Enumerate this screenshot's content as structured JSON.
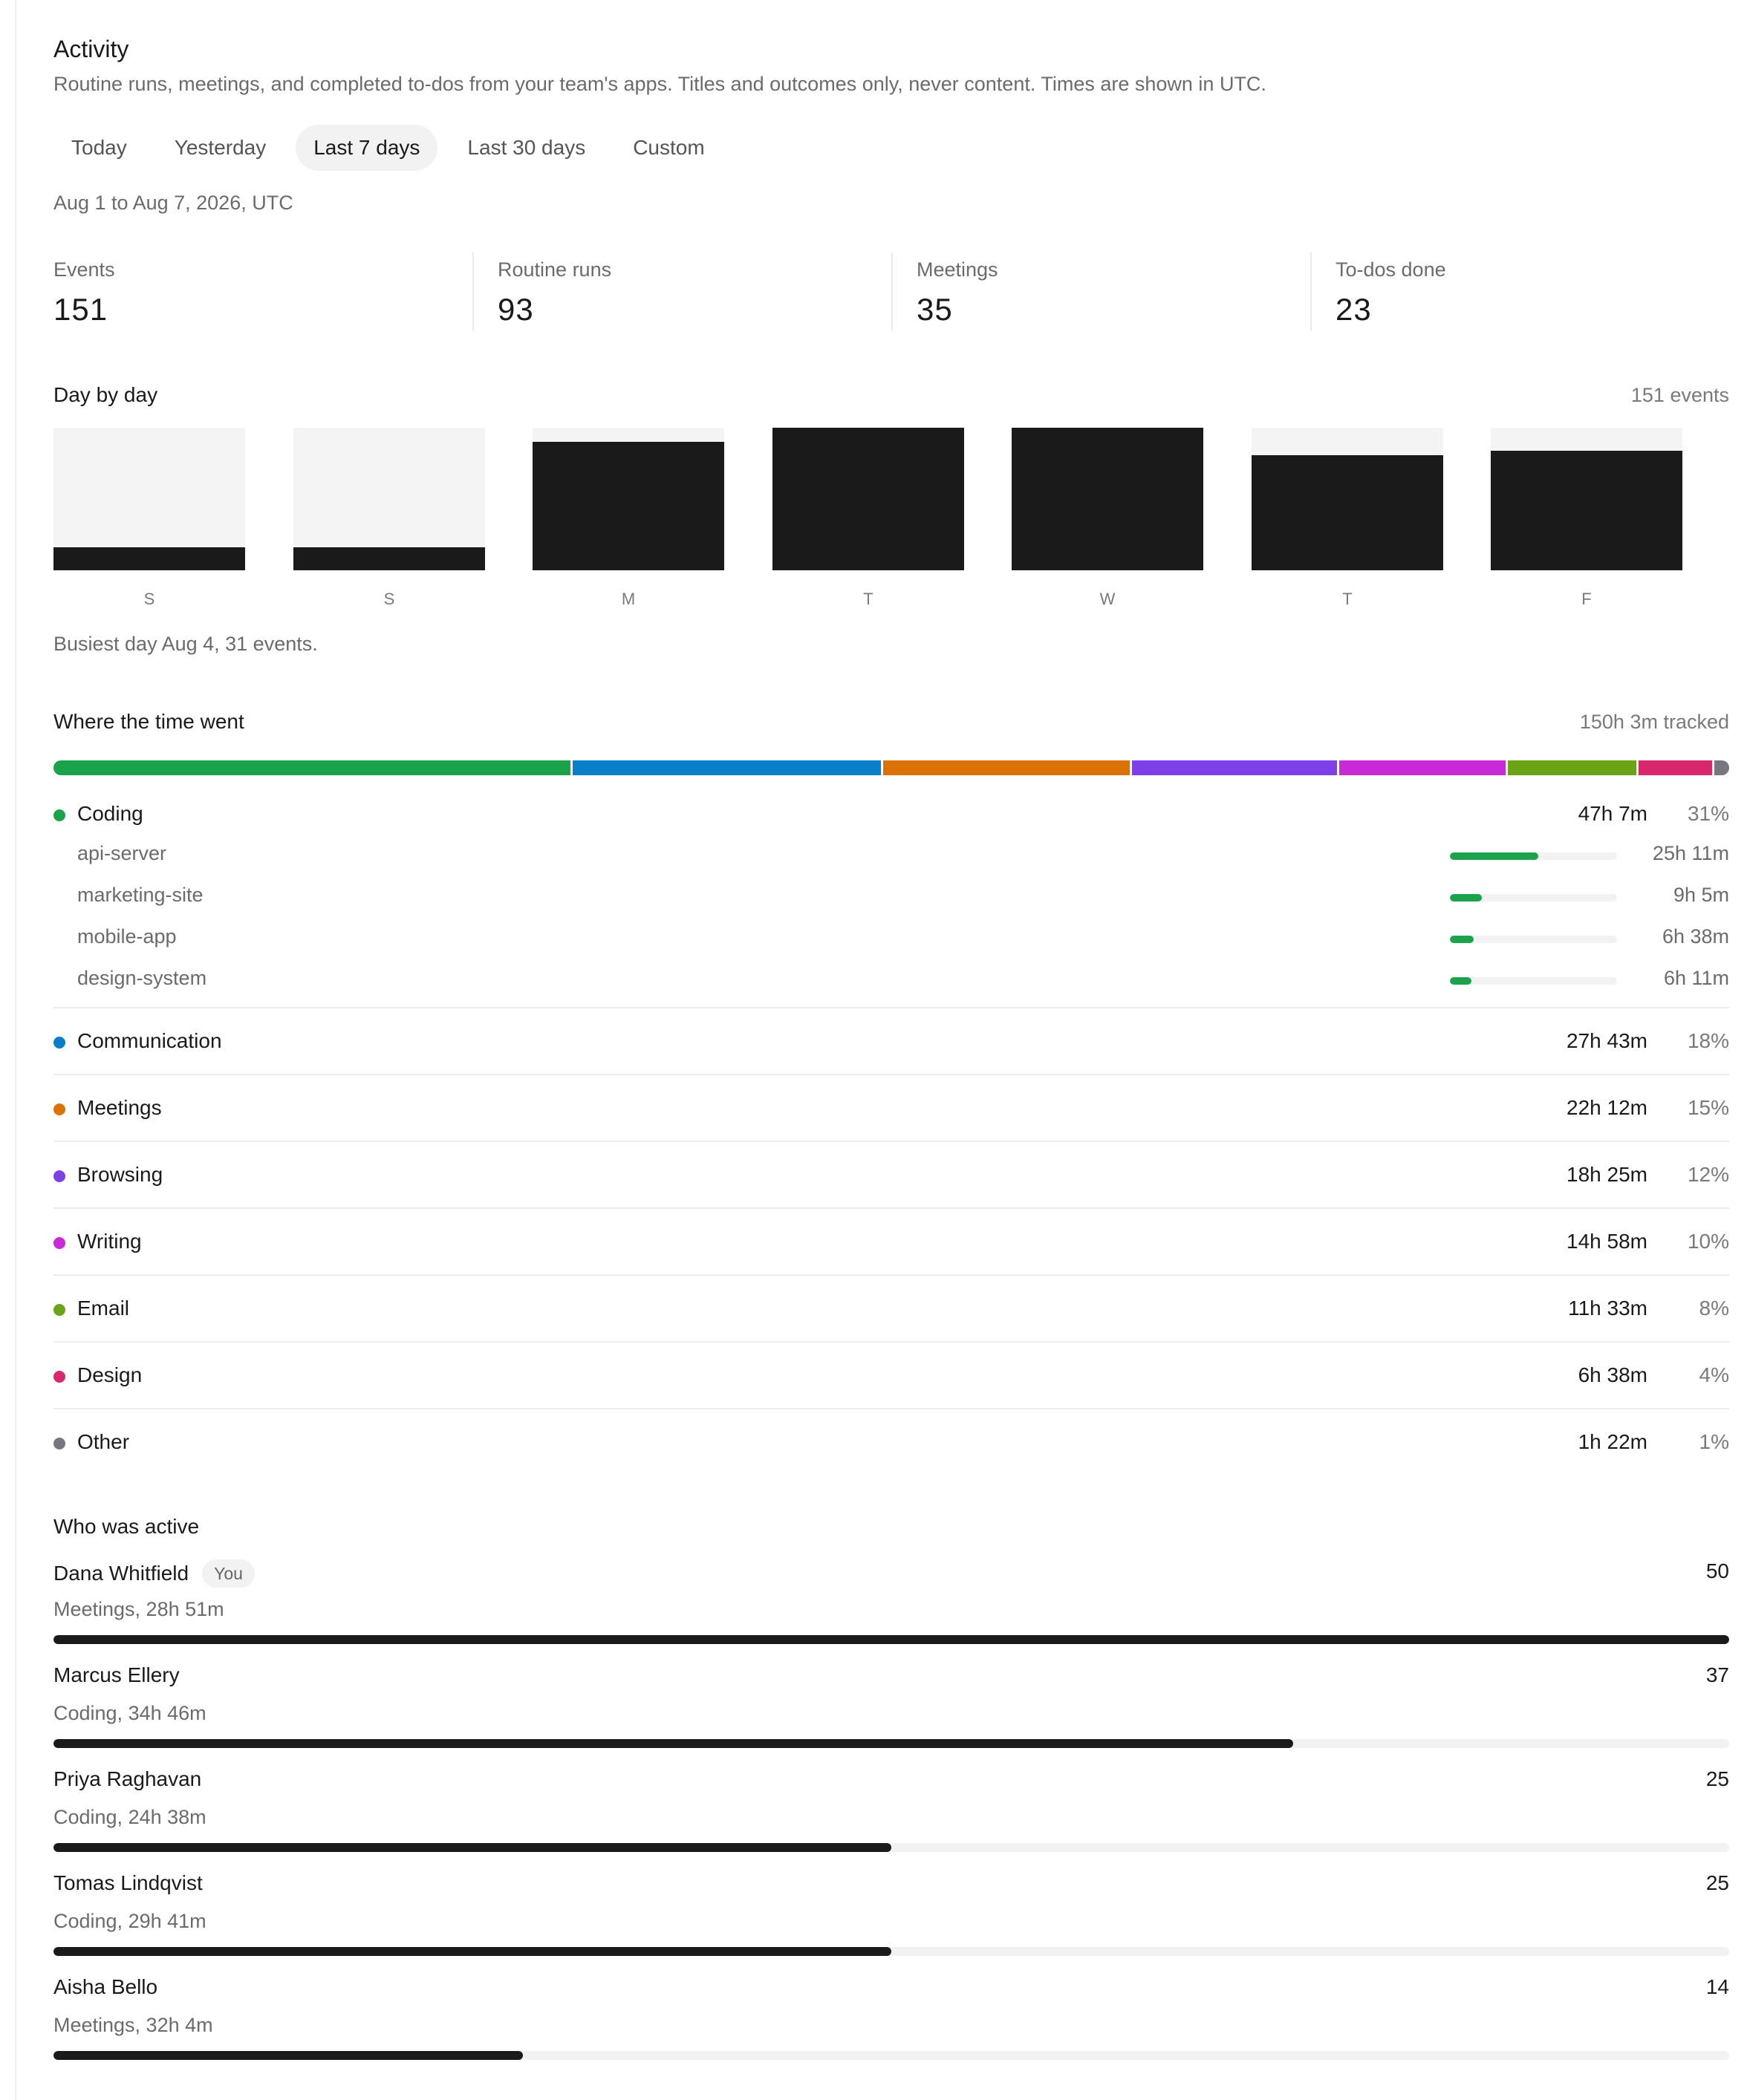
{
  "header": {
    "title": "Activity",
    "subtitle": "Routine runs, meetings, and completed to-dos from your team's apps. Titles and outcomes only, never content. Times are shown in UTC."
  },
  "tabs": [
    {
      "label": "Today",
      "active": false
    },
    {
      "label": "Yesterday",
      "active": false
    },
    {
      "label": "Last 7 days",
      "active": true
    },
    {
      "label": "Last 30 days",
      "active": false
    },
    {
      "label": "Custom",
      "active": false
    }
  ],
  "range_label": "Aug 1 to Aug 7, 2026, UTC",
  "stats": [
    {
      "label": "Events",
      "value": "151"
    },
    {
      "label": "Routine runs",
      "value": "93"
    },
    {
      "label": "Meetings",
      "value": "35"
    },
    {
      "label": "To-dos done",
      "value": "23"
    }
  ],
  "day_by_day": {
    "title": "Day by day",
    "meta": "151 events",
    "busiest": "Busiest day Aug 4, 31 events."
  },
  "chart_data": {
    "type": "bar",
    "categories": [
      "S",
      "S",
      "M",
      "T",
      "W",
      "T",
      "F"
    ],
    "values": [
      5,
      5,
      28,
      31,
      31,
      25,
      26
    ],
    "ylim": [
      0,
      31
    ],
    "grid": false
  },
  "time_section": {
    "title": "Where the time went",
    "meta": "150h 3m tracked"
  },
  "categories": [
    {
      "name": "Coding",
      "time": "47h 7m",
      "pct": "31%",
      "share": 31,
      "color": "#1aa34a",
      "children": [
        {
          "name": "api-server",
          "time": "25h 11m",
          "fraction": 0.53
        },
        {
          "name": "marketing-site",
          "time": "9h 5m",
          "fraction": 0.19
        },
        {
          "name": "mobile-app",
          "time": "6h 38m",
          "fraction": 0.14
        },
        {
          "name": "design-system",
          "time": "6h 11m",
          "fraction": 0.13
        }
      ]
    },
    {
      "name": "Communication",
      "time": "27h 43m",
      "pct": "18%",
      "share": 18.5,
      "color": "#0a7fc9",
      "children": []
    },
    {
      "name": "Meetings",
      "time": "22h 12m",
      "pct": "15%",
      "share": 14.8,
      "color": "#db7208",
      "children": []
    },
    {
      "name": "Browsing",
      "time": "18h 25m",
      "pct": "12%",
      "share": 12.3,
      "color": "#7d3fe8",
      "children": []
    },
    {
      "name": "Writing",
      "time": "14h 58m",
      "pct": "10%",
      "share": 10,
      "color": "#c92ad8",
      "children": []
    },
    {
      "name": "Email",
      "time": "11h 33m",
      "pct": "8%",
      "share": 7.7,
      "color": "#6aa313",
      "children": []
    },
    {
      "name": "Design",
      "time": "6h 38m",
      "pct": "4%",
      "share": 4.4,
      "color": "#d9276e",
      "children": []
    },
    {
      "name": "Other",
      "time": "1h 22m",
      "pct": "1%",
      "share": 0.9,
      "color": "#77777f",
      "children": []
    }
  ],
  "people_section": {
    "title": "Who was active"
  },
  "people": [
    {
      "name": "Dana Whitfield",
      "badge": "You",
      "detail": "Meetings, 28h 51m",
      "count": "50",
      "fraction": 1.0
    },
    {
      "name": "Marcus Ellery",
      "badge": "",
      "detail": "Coding, 34h 46m",
      "count": "37",
      "fraction": 0.74
    },
    {
      "name": "Priya Raghavan",
      "badge": "",
      "detail": "Coding, 24h 38m",
      "count": "25",
      "fraction": 0.5
    },
    {
      "name": "Tomas Lindqvist",
      "badge": "",
      "detail": "Coding, 29h 41m",
      "count": "25",
      "fraction": 0.5
    },
    {
      "name": "Aisha Bello",
      "badge": "",
      "detail": "Meetings, 32h 4m",
      "count": "14",
      "fraction": 0.28
    }
  ]
}
